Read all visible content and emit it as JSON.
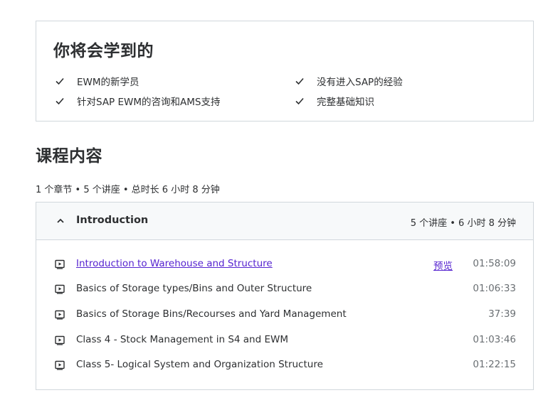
{
  "learn": {
    "title": "你将会学到的",
    "items": [
      "EWM的新学员",
      "针对SAP EWM的咨询和AMS支持",
      "没有进入SAP的经验",
      "完整基础知识"
    ]
  },
  "content": {
    "heading": "课程内容",
    "summary": "1 个章节 • 5 个讲座 • 总时长 6 小时 8 分钟"
  },
  "section": {
    "title": "Introduction",
    "meta": "5 个讲座 • 6 小时 8 分钟",
    "lectures": [
      {
        "title": "Introduction to Warehouse and Structure",
        "preview": "预览",
        "duration": "01:58:09"
      },
      {
        "title": "Basics of Storage types/Bins and Outer Structure",
        "duration": "01:06:33"
      },
      {
        "title": "Basics of Storage Bins/Recourses and Yard Management",
        "duration": "37:39"
      },
      {
        "title": "Class 4 - Stock Management in S4 and EWM",
        "duration": "01:03:46"
      },
      {
        "title": "Class 5- Logical System and Organization Structure",
        "duration": "01:22:15"
      }
    ]
  },
  "colors": {
    "text": "#2d2f31",
    "link": "#5624d0",
    "border": "#d1d7dc",
    "header_bg": "#f7f9fa",
    "muted": "#6a6f73"
  }
}
